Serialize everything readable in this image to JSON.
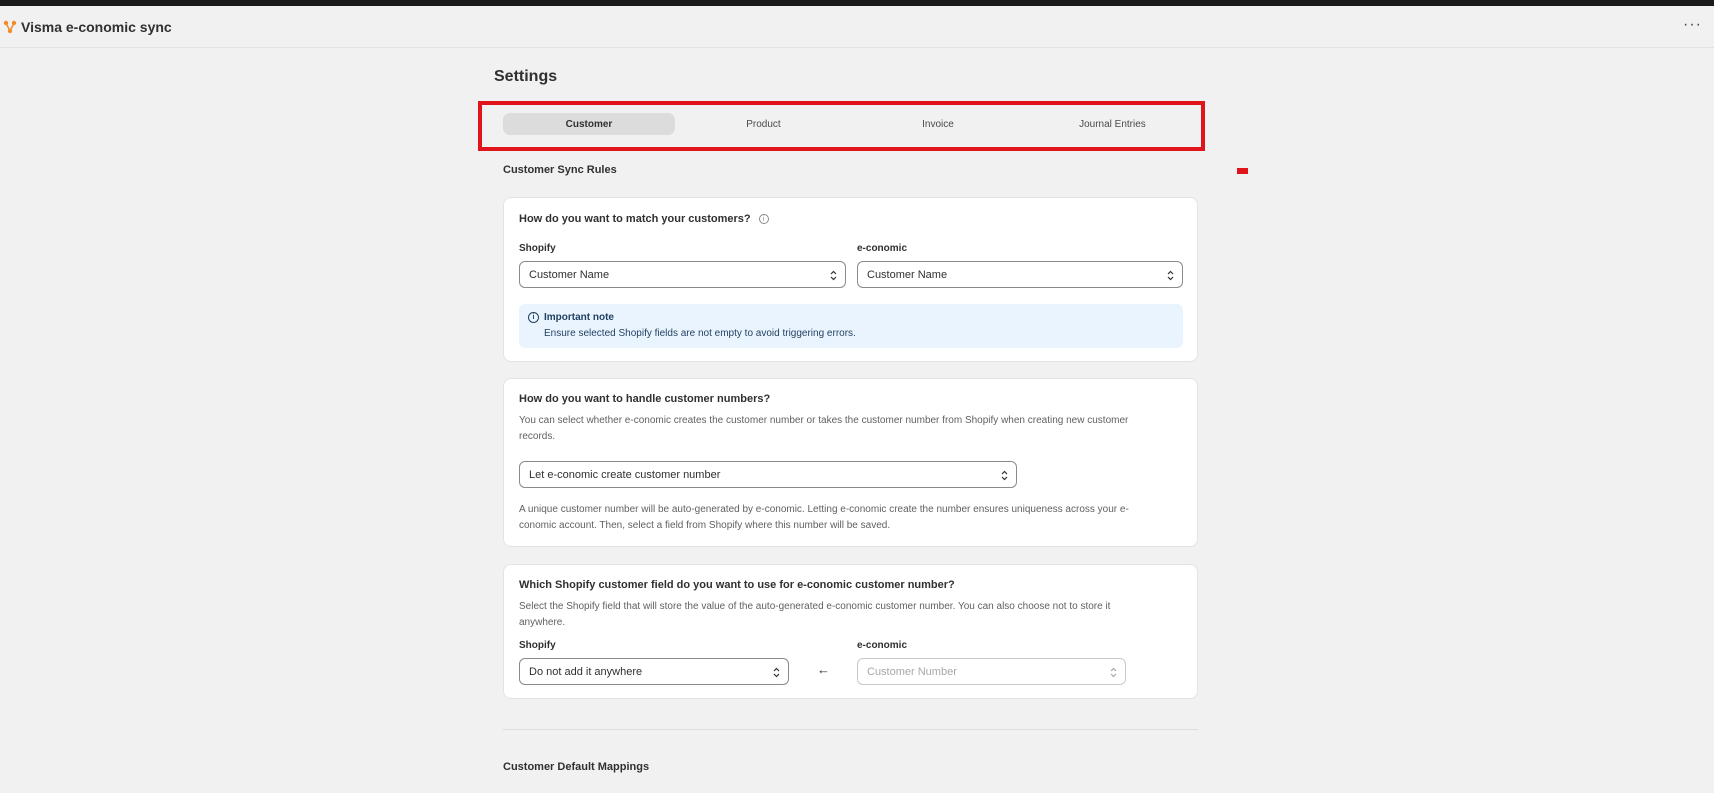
{
  "app": {
    "title": "Visma e-conomic sync",
    "more_label": "···"
  },
  "page": {
    "title": "Settings"
  },
  "tabs": [
    {
      "label": "Customer",
      "active": true
    },
    {
      "label": "Product",
      "active": false
    },
    {
      "label": "Invoice",
      "active": false
    },
    {
      "label": "Journal Entries",
      "active": false
    }
  ],
  "sync_rules": {
    "title": "Customer Sync Rules",
    "match_card": {
      "question": "How do you want to match your customers?",
      "shopify_label": "Shopify",
      "shopify_value": "Customer Name",
      "economic_label": "e-conomic",
      "economic_value": "Customer Name",
      "note_title": "Important note",
      "note_text": "Ensure selected Shopify fields are not empty to avoid triggering errors."
    },
    "numbers_card": {
      "question": "How do you want to handle customer numbers?",
      "description_line1": "You can select whether e-conomic creates the customer number or takes the customer number from Shopify when creating new customer",
      "description_line2": "records.",
      "select_value": "Let e-conomic create customer number",
      "help_line1": "A unique customer number will be auto-generated by e-conomic. Letting e-conomic create the number ensures uniqueness across your e-",
      "help_line2": "conomic account. Then, select a field from Shopify where this number will be saved."
    },
    "field_card": {
      "question": "Which Shopify customer field do you want to use for e-conomic customer number?",
      "description_line1": "Select the Shopify field that will store the value of the auto-generated e-conomic customer number. You can also choose not to store it",
      "description_line2": "anywhere.",
      "shopify_label": "Shopify",
      "shopify_value": "Do not add it anywhere",
      "arrow": "←",
      "economic_label": "e-conomic",
      "economic_placeholder": "Customer Number"
    }
  },
  "default_mappings": {
    "title": "Customer Default Mappings"
  },
  "colors": {
    "highlight": "#e0151b",
    "note_bg": "#eaf4ff",
    "page_bg": "#f1f1f1",
    "logo": "#f28c28"
  },
  "icons": [
    "app-logo-icon",
    "more-icon",
    "info-icon",
    "chevron-updown-icon",
    "arrow-left-icon"
  ]
}
